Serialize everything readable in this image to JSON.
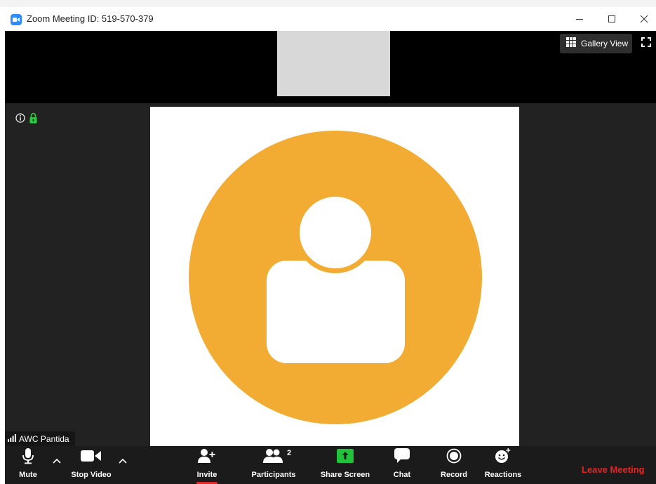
{
  "window": {
    "title": "Zoom Meeting ID: 519-570-379"
  },
  "view": {
    "gallery_label": "Gallery View"
  },
  "participant": {
    "name": "AWC Pantida",
    "avatar_color": "#f2ac33"
  },
  "toolbar": {
    "mute": "Mute",
    "stop_video": "Stop Video",
    "invite": "Invite",
    "participants": "Participants",
    "participants_count": "2",
    "share_screen": "Share Screen",
    "chat": "Chat",
    "record": "Record",
    "reactions": "Reactions",
    "leave": "Leave Meeting"
  },
  "colors": {
    "accent": "#2d8cff",
    "share_green": "#20c33b",
    "leave_red": "#e02828",
    "lock_green": "#25d13b"
  },
  "icons": {
    "mic": "microphone-icon",
    "video": "video-camera-icon",
    "invite": "add-person-icon",
    "participants": "people-icon",
    "share": "share-arrow-icon",
    "chat": "speech-bubble-icon",
    "record": "record-circle-icon",
    "reactions": "smiley-plus-icon"
  }
}
